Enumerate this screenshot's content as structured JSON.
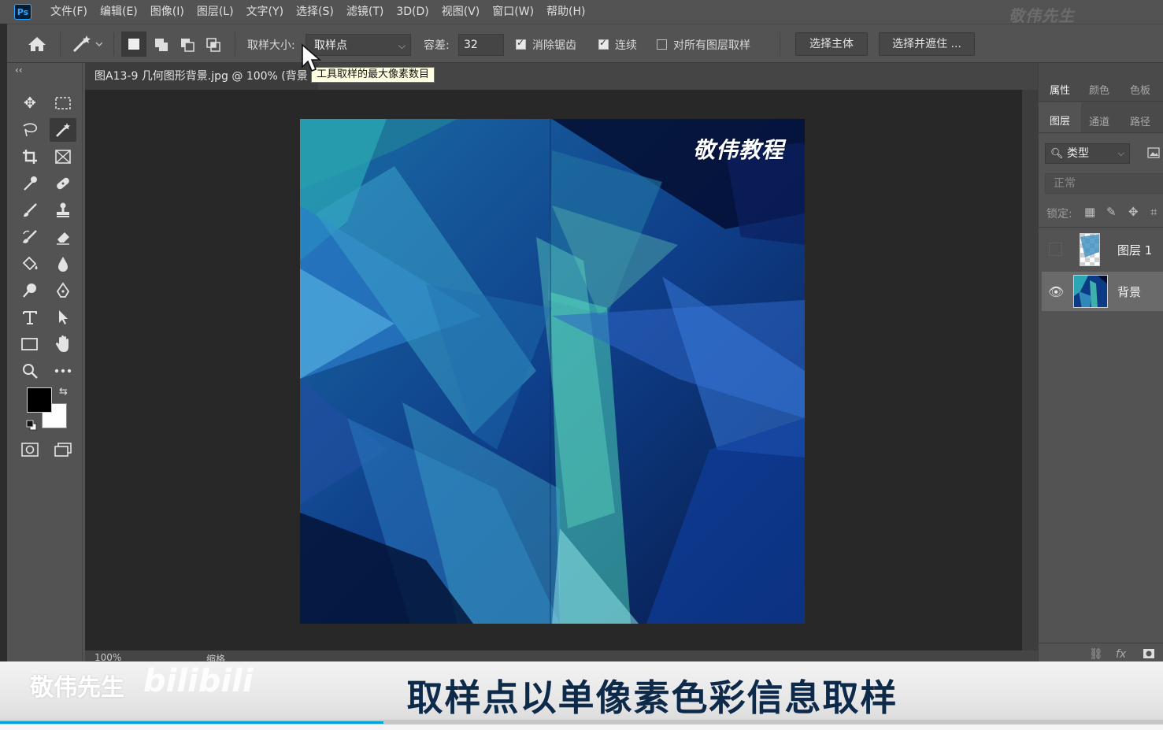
{
  "app": {
    "logo_text": "Ps",
    "watermark": "敬伟先生"
  },
  "menu": [
    "文件(F)",
    "编辑(E)",
    "图像(I)",
    "图层(L)",
    "文字(Y)",
    "选择(S)",
    "滤镜(T)",
    "3D(D)",
    "视图(V)",
    "窗口(W)",
    "帮助(H)"
  ],
  "options_bar": {
    "sample_size_label": "取样大小:",
    "sample_size_value": "取样点",
    "tolerance_label": "容差:",
    "tolerance_value": "32",
    "anti_alias_label": "消除锯齿",
    "anti_alias_checked": true,
    "contiguous_label": "连续",
    "contiguous_checked": true,
    "sample_all_layers_label": "对所有图层取样",
    "sample_all_layers_checked": false,
    "select_subject_label": "选择主体",
    "select_and_mask_label": "选择并遮住 ..."
  },
  "tooltip": "工具取样的最大像素数目",
  "document": {
    "tab_title": "图A13-9 几何图形背景.jpg @ 100% (背景",
    "artwork_title": "敬伟教程",
    "zoom": "100%",
    "status_info": "缩格"
  },
  "panels": {
    "top_tabs": [
      "属性",
      "颜色",
      "色板"
    ],
    "layer_tabs": [
      "图层",
      "通道",
      "路径"
    ],
    "filter_label": "类型",
    "blend_mode": "正常",
    "lock_label": "锁定:",
    "layers": [
      {
        "name": "图层 1",
        "visible": false,
        "selected": false
      },
      {
        "name": "背景",
        "visible": true,
        "selected": true
      }
    ]
  },
  "subtitle": {
    "channel": "敬伟先生",
    "site_logo": "bilibili",
    "text": "取样点以单像素色彩信息取样"
  },
  "colors": {
    "accent": "#31a8ff",
    "tooltip_bg": "#ffffe1",
    "subtitle_text": "#0e2a4a",
    "progress": "#00a1d6"
  },
  "video_progress": 0.33
}
